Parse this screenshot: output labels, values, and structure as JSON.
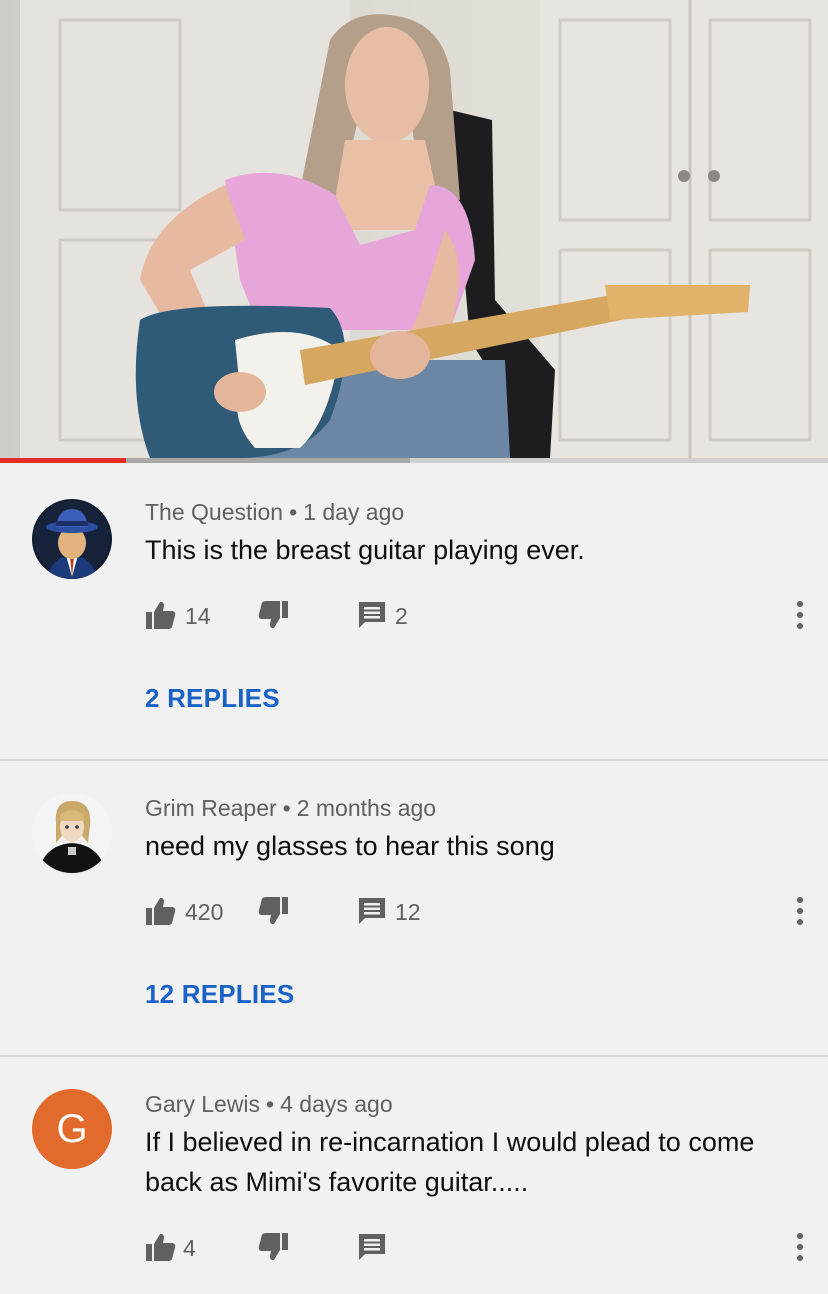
{
  "player": {
    "played_fraction": 0.152,
    "buffered_fraction": 0.495,
    "accent_color": "#e52d27"
  },
  "comments": [
    {
      "author": "The Question",
      "age": "1 day ago",
      "text": "This is the breast guitar playing ever.",
      "likes": "14",
      "reply_count": "2",
      "replies_label": "2 REPLIES",
      "avatar_icon": "fedora-detective-avatar"
    },
    {
      "author": "Grim Reaper",
      "age": "2 months ago",
      "text": "need my glasses to hear this song",
      "likes": "420",
      "reply_count": "12",
      "replies_label": "12 REPLIES",
      "avatar_icon": "anime-character-avatar"
    },
    {
      "author": "Gary Lewis",
      "age": "4 days ago",
      "text": "If I believed in re-incarnation I would plead to come back as Mimi's favorite guitar.....",
      "likes": "4",
      "reply_count": "",
      "avatar_letter": "G",
      "avatar_color": "#e26a2c"
    }
  ],
  "meta_separator": "•",
  "colors": {
    "link_blue": "#1a62c6",
    "secondary_text": "#606060",
    "background": "#f1f1f1"
  }
}
